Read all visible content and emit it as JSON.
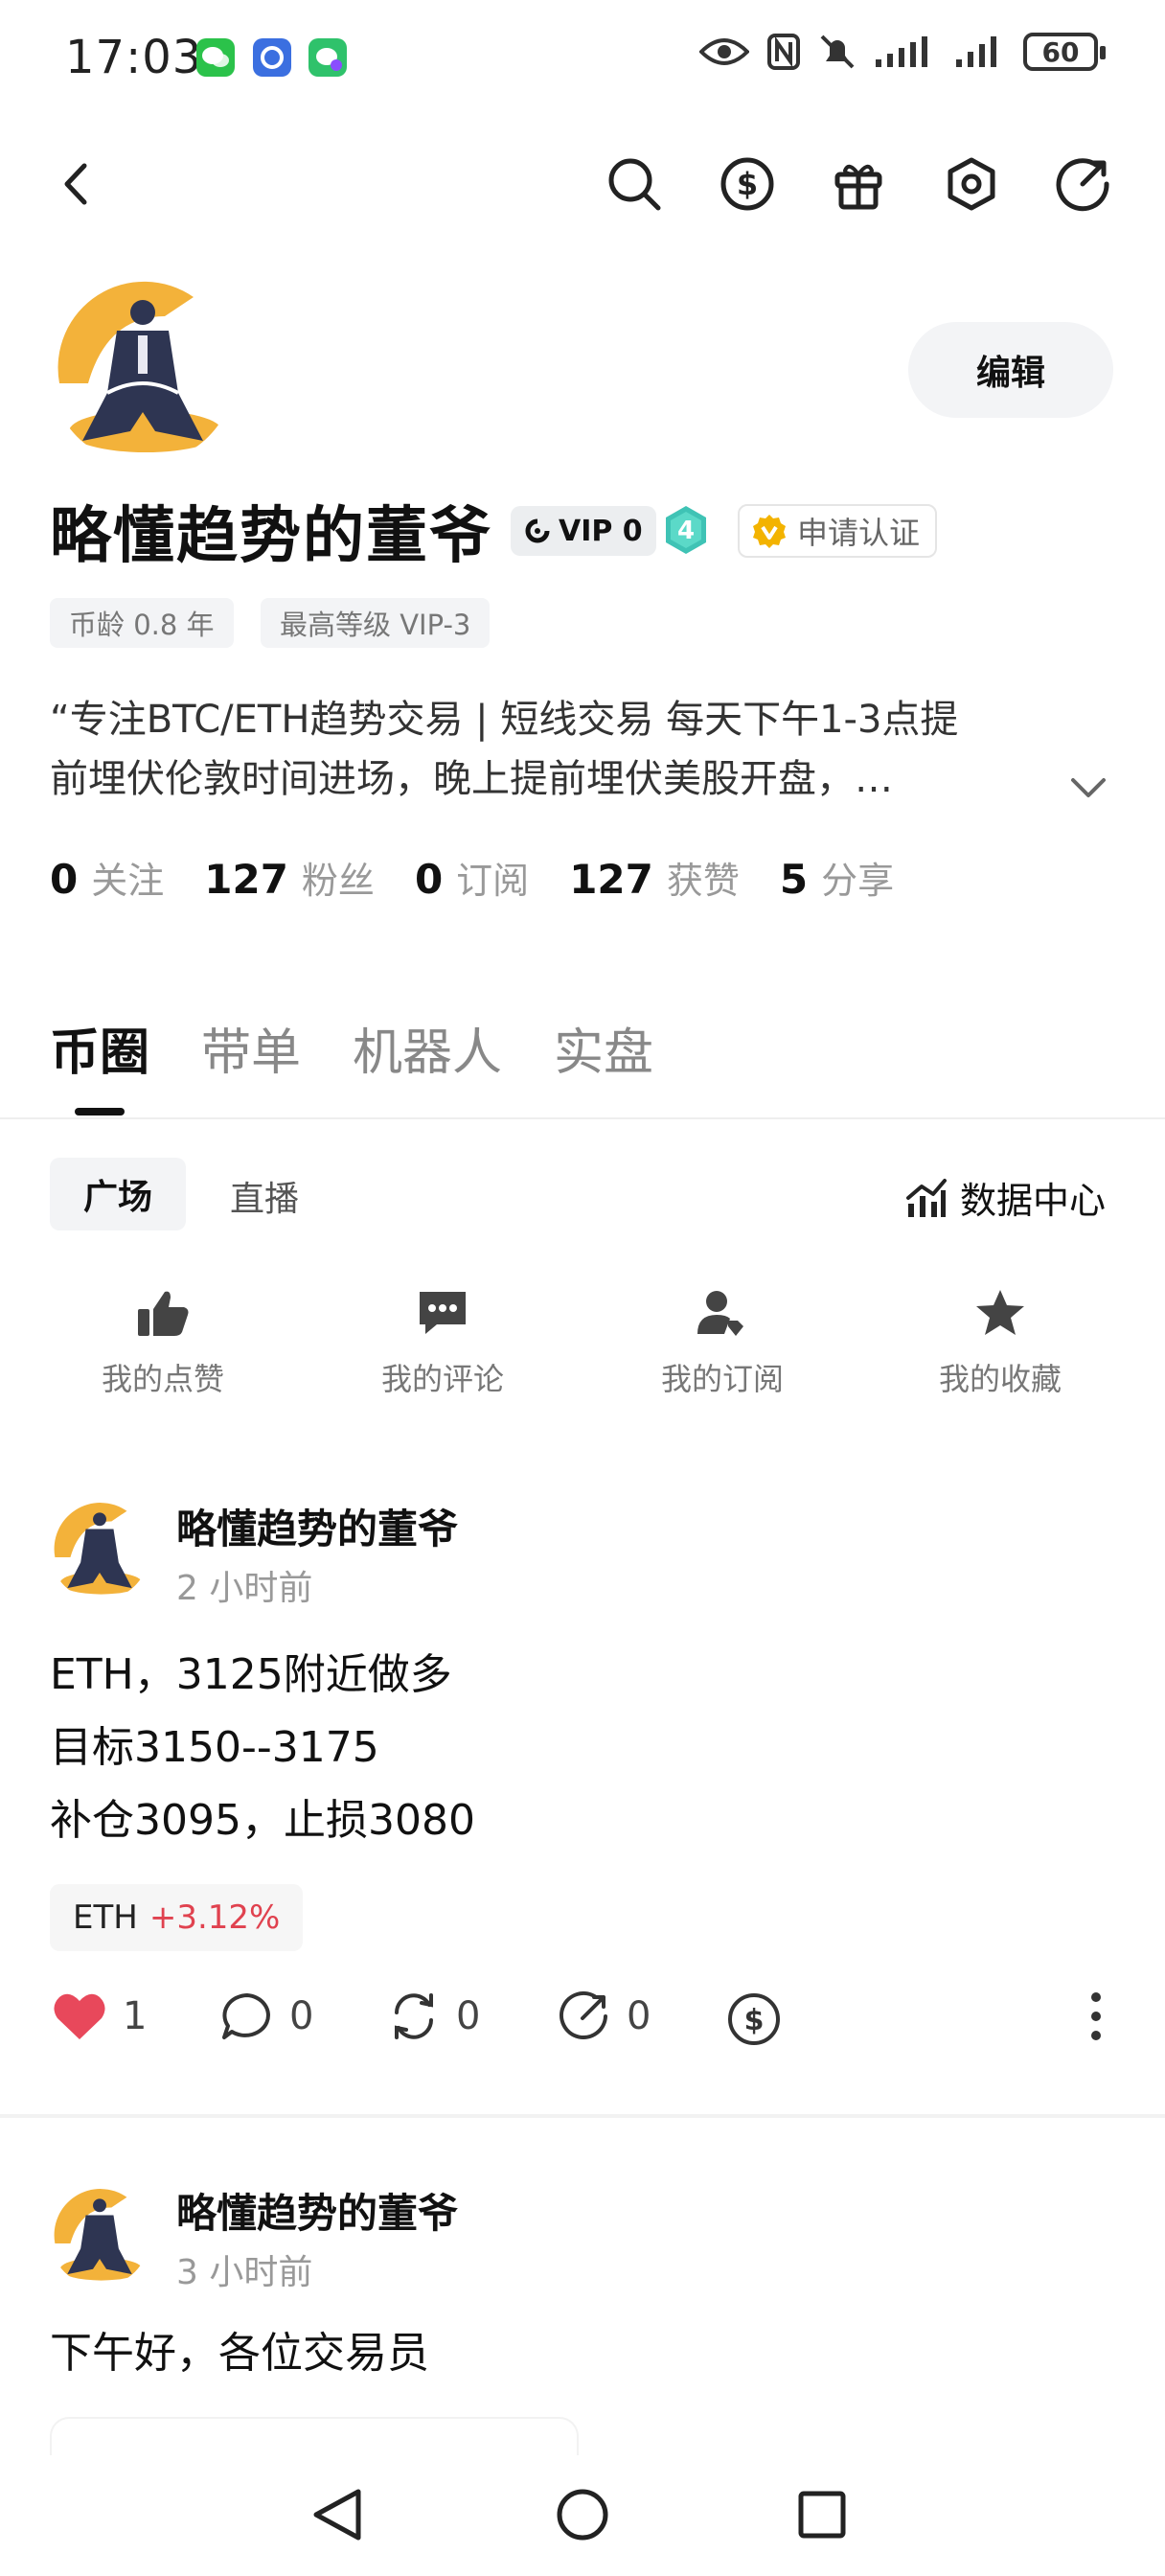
{
  "status_bar": {
    "time": "17:03",
    "battery": "60"
  },
  "profile": {
    "name": "略懂趋势的董爷",
    "edit_label": "编辑",
    "vip_label": "VIP 0",
    "level": "4",
    "cert_label": "申请认证",
    "tags": [
      "币龄 0.8 年",
      "最高等级 VIP-3"
    ],
    "bio_line1": "“专注BTC/ETH趋势交易 | 短线交易 每天下午1-3点提",
    "bio_line2": "前埋伏伦敦时间进场，晚上提前埋伏美股开盘，…",
    "stats": [
      {
        "value": "0",
        "label": "关注"
      },
      {
        "value": "127",
        "label": "粉丝"
      },
      {
        "value": "0",
        "label": "订阅"
      },
      {
        "value": "127",
        "label": "获赞"
      },
      {
        "value": "5",
        "label": "分享"
      }
    ]
  },
  "tabs": [
    "币圈",
    "带单",
    "机器人",
    "实盘"
  ],
  "subtabs": {
    "active": "广场",
    "other": "直播",
    "data_center": "数据中心"
  },
  "quick_actions": [
    "我的点赞",
    "我的评论",
    "我的订阅",
    "我的收藏"
  ],
  "posts": [
    {
      "author": "略懂趋势的董爷",
      "time": "2 小时前",
      "lines": [
        "ETH，3125附近做多",
        "目标3150--3175",
        "补仓3095，止损3080"
      ],
      "ticker": "ETH",
      "ticker_change": "+3.12%",
      "likes": "1",
      "comments": "0",
      "reposts": "0",
      "shares": "0"
    },
    {
      "author": "略懂趋势的董爷",
      "time": "3 小时前",
      "lines": [
        "下午好，各位交易员"
      ]
    }
  ]
}
